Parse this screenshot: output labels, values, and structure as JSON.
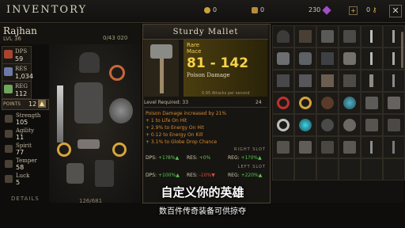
{
  "header": {
    "title": "INVENTORY",
    "gold": "0",
    "bag": "0",
    "gems": "230",
    "keys": "0",
    "close": "✕"
  },
  "hero": {
    "name": "Rajhan",
    "level": "LVL 36",
    "slots": "0/43 020"
  },
  "stats": [
    {
      "label": "DPS",
      "value": "59",
      "color": "#a8432f"
    },
    {
      "label": "RES",
      "value": "1,034",
      "color": "#6d7aa8"
    },
    {
      "label": "REG",
      "value": "112",
      "color": "#6fa55c"
    }
  ],
  "points": {
    "label": "POINTS",
    "value": "12"
  },
  "attributes": [
    {
      "label": "Strength",
      "value": "105"
    },
    {
      "label": "Agility",
      "value": "11"
    },
    {
      "label": "Spirit",
      "value": "77"
    },
    {
      "label": "Temper",
      "value": "58"
    },
    {
      "label": "Luck",
      "value": "5"
    }
  ],
  "details_label": "DETAILS",
  "capacity": "126/681",
  "item": {
    "name": "Sturdy Mallet",
    "rarity": "Rare",
    "type": "Mace",
    "damage": "81 - 142",
    "damage_type": "Poison Damage",
    "aps": "0.95 Attacks per second",
    "level_label": "Level Required: 33",
    "level_value": "24",
    "bonuses": [
      "Poison Damage increased by 21%",
      "+ 1 to Life On Hit",
      "+ 2.9% to Energy On Hit",
      "+ 0.12 to Energy On Kill",
      "+ 3.1% to Globe Drop Chance"
    ],
    "right_slot": {
      "label": "RIGHT SLOT",
      "dps": "DPS:",
      "dps_val": "+1?8%",
      "res": "RES:",
      "res_val": "+0%",
      "reg": "REG:",
      "reg_val": "+1?0%"
    },
    "left_slot": {
      "label": "LEFT SLOT",
      "dps": "DPS:",
      "dps_val": "+100%",
      "res": "RES:",
      "res_val": "-10%",
      "reg": "REG:",
      "reg_val": "+220%"
    }
  },
  "subtitle": {
    "main": "自定义你的英雄",
    "sub": "数百件传奇装备可供掠夺"
  }
}
